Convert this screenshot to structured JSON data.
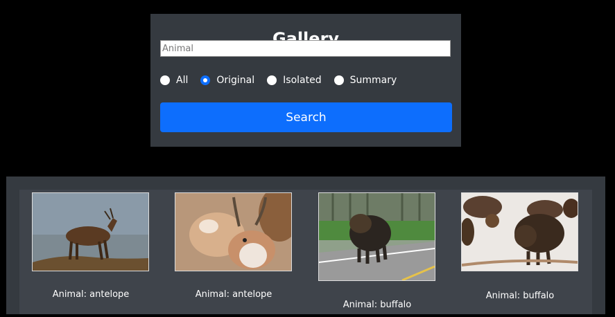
{
  "search": {
    "title": "Gallery",
    "placeholder": "Animal",
    "value": "",
    "options": [
      {
        "label": "All",
        "checked": false
      },
      {
        "label": "Original",
        "checked": true
      },
      {
        "label": "Isolated",
        "checked": false
      },
      {
        "label": "Summary",
        "checked": false
      }
    ],
    "button_label": "Search"
  },
  "results": {
    "items": [
      {
        "caption": "Animal: antelope"
      },
      {
        "caption": "Animal: antelope"
      },
      {
        "caption": "Animal: buffalo"
      },
      {
        "caption": "Animal: buffalo"
      }
    ]
  }
}
